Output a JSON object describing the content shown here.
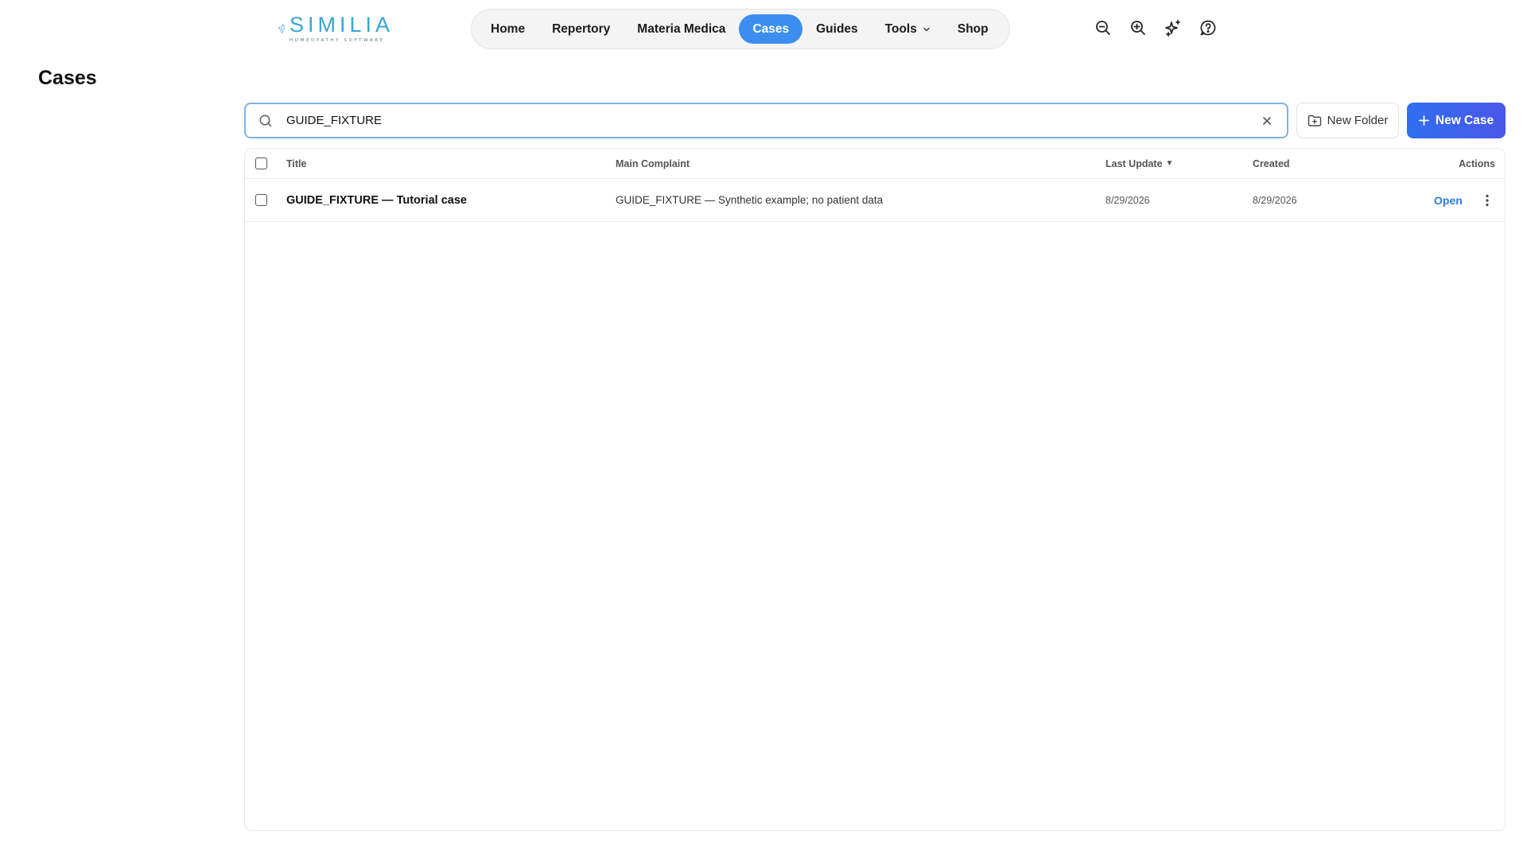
{
  "app": {
    "logo_word": "SIMILIA",
    "logo_tagline": "HOMEOPATHY SOFTWARE",
    "brand_color": "#3aa3d9"
  },
  "nav": {
    "items": [
      {
        "label": "Home",
        "active": false
      },
      {
        "label": "Repertory",
        "active": false
      },
      {
        "label": "Materia Medica",
        "active": false
      },
      {
        "label": "Cases",
        "active": true
      },
      {
        "label": "Guides",
        "active": false
      },
      {
        "label": "Tools",
        "active": false,
        "has_dropdown": true
      },
      {
        "label": "Shop",
        "active": false
      }
    ],
    "active_color": "#3b8ef0"
  },
  "toolbar_icons": [
    "zoom-out-icon",
    "zoom-in-icon",
    "sparkles-icon",
    "help-icon"
  ],
  "page": {
    "title": "Cases"
  },
  "search": {
    "value": "GUIDE_FIXTURE",
    "placeholder": ""
  },
  "actions": {
    "new_folder_label": "New Folder",
    "new_case_label": "New Case"
  },
  "table": {
    "columns": {
      "title": "Title",
      "main_complaint": "Main Complaint",
      "last_update": "Last Update",
      "created": "Created",
      "actions": "Actions"
    },
    "sort": {
      "column": "last_update",
      "direction": "desc",
      "indicator": "▼"
    },
    "rows": [
      {
        "title": "GUIDE_FIXTURE — Tutorial case",
        "main_complaint": "GUIDE_FIXTURE — Synthetic example; no patient data",
        "last_update": "8/29/2026",
        "created": "8/29/2026",
        "open_label": "Open"
      }
    ]
  }
}
